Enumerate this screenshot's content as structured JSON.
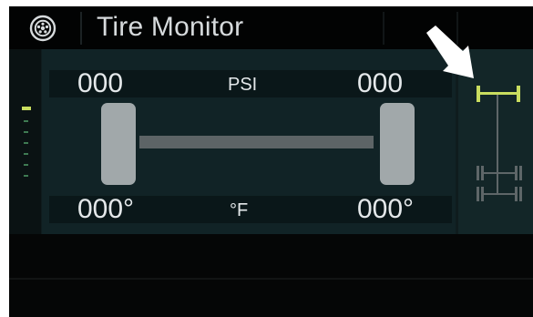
{
  "header": {
    "icon": "tire-icon",
    "title": "Tire Monitor"
  },
  "pressure": {
    "left_front": "000",
    "unit": "PSI",
    "right_front": "000"
  },
  "temperature": {
    "left_front": "000°",
    "unit": "°F",
    "right_front": "000°"
  },
  "axle_selector": {
    "selected_axle": "front",
    "icon": "axle-diagram-icon",
    "pointer_icon": "arrow-pointer-icon"
  },
  "page_indicator": {
    "total_pages": 6,
    "current_page": 1
  },
  "colors": {
    "highlight": "#c9dd5f",
    "panel": "#112326",
    "tire": "#a1a8aa",
    "text": "#e4e8ea"
  }
}
